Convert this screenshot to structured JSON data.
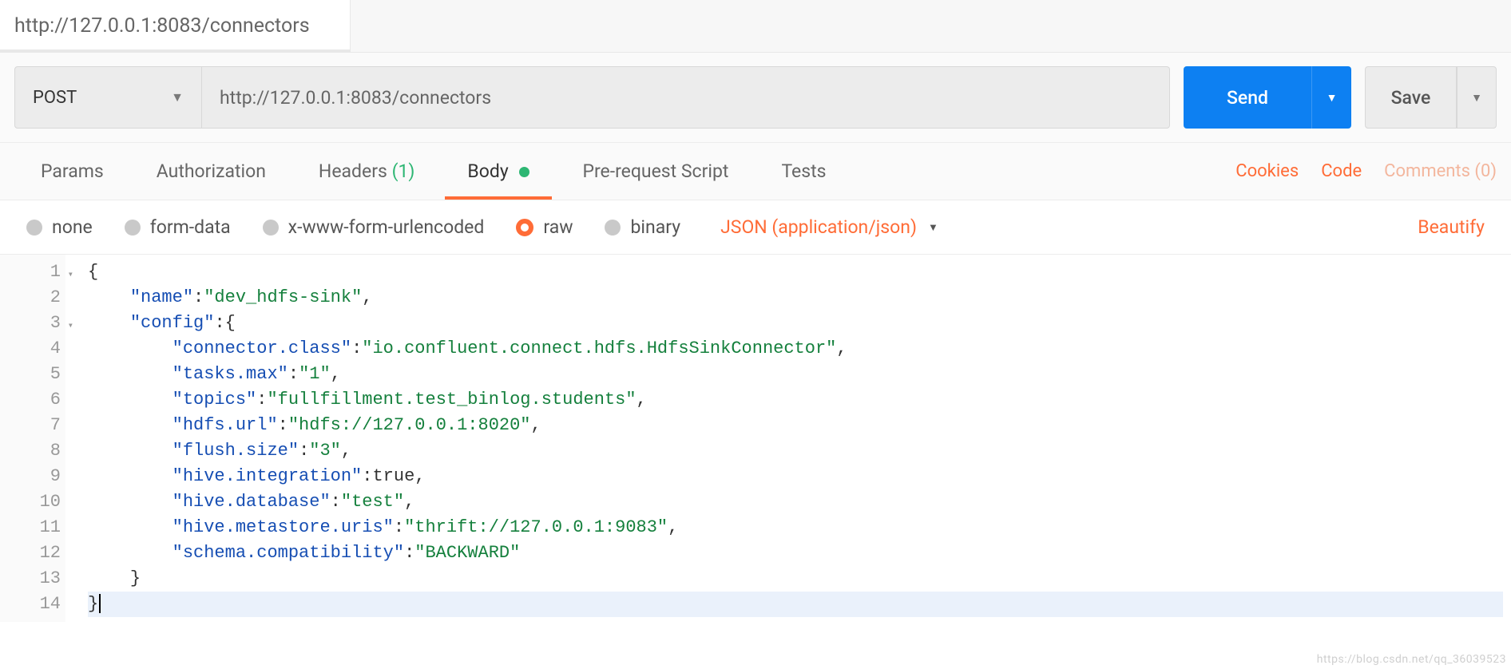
{
  "tab": {
    "title": "http://127.0.0.1:8083/connectors"
  },
  "request": {
    "method": "POST",
    "url": "http://127.0.0.1:8083/connectors",
    "send_label": "Send",
    "save_label": "Save"
  },
  "req_tabs": {
    "params": "Params",
    "auth": "Authorization",
    "headers": "Headers",
    "headers_count": "(1)",
    "body": "Body",
    "prerequest": "Pre-request Script",
    "tests": "Tests"
  },
  "right_links": {
    "cookies": "Cookies",
    "code": "Code",
    "comments": "Comments (0)"
  },
  "body_opts": {
    "none": "none",
    "form_data": "form-data",
    "urlencoded": "x-www-form-urlencoded",
    "raw": "raw",
    "binary": "binary",
    "content_type": "JSON (application/json)",
    "beautify": "Beautify"
  },
  "editor": {
    "lines": [
      "1",
      "2",
      "3",
      "4",
      "5",
      "6",
      "7",
      "8",
      "9",
      "10",
      "11",
      "12",
      "13",
      "14"
    ],
    "fold_lines": [
      "1",
      "3"
    ],
    "body": {
      "name": "dev_hdfs-sink",
      "config": {
        "connector.class": "io.confluent.connect.hdfs.HdfsSinkConnector",
        "tasks.max": "1",
        "topics": "fullfillment.test_binlog.students",
        "hdfs.url": "hdfs://127.0.0.1:8020",
        "flush.size": "3",
        "hive.integration": true,
        "hive.database": "test",
        "hive.metastore.uris": "thrift://127.0.0.1:9083",
        "schema.compatibility": "BACKWARD"
      }
    }
  },
  "watermark": "https://blog.csdn.net/qq_36039523"
}
